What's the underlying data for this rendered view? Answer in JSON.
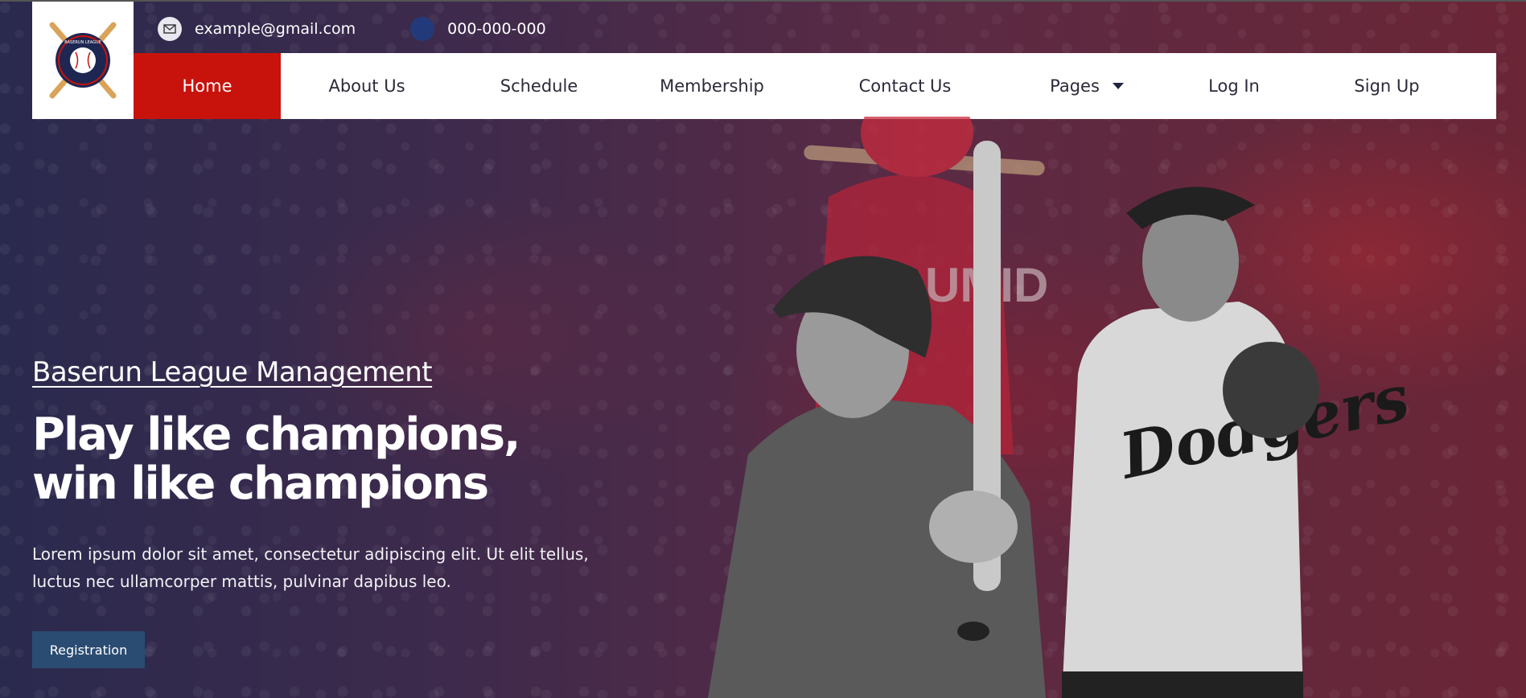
{
  "header": {
    "email": "example@gmail.com",
    "phone": "000-000-000",
    "email_icon": "mail-icon",
    "phone_icon": "phone-icon"
  },
  "logo": {
    "name": "baseball-league-logo",
    "text": "BASERUN LEAGUE"
  },
  "nav": {
    "items": [
      {
        "label": "Home",
        "active": true
      },
      {
        "label": "About Us"
      },
      {
        "label": "Schedule"
      },
      {
        "label": "Membership"
      },
      {
        "label": "Contact Us"
      },
      {
        "label": "Pages",
        "dropdown": true
      },
      {
        "label": "Log In"
      },
      {
        "label": "Sign Up"
      }
    ]
  },
  "hero": {
    "eyebrow": "Baserun League Management",
    "headline": "Play like champions, win like champions",
    "lead": "Lorem ipsum dolor sit amet, consectetur adipiscing elit. Ut elit tellus, luctus nec ullamcorper mattis, pulvinar dapibus leo.",
    "cta": "Registration",
    "jersey_text": "Dodgers"
  },
  "colors": {
    "accent_red": "#c8130c",
    "button_blue": "#2b4c72",
    "nav_text": "#2a2a3a"
  }
}
